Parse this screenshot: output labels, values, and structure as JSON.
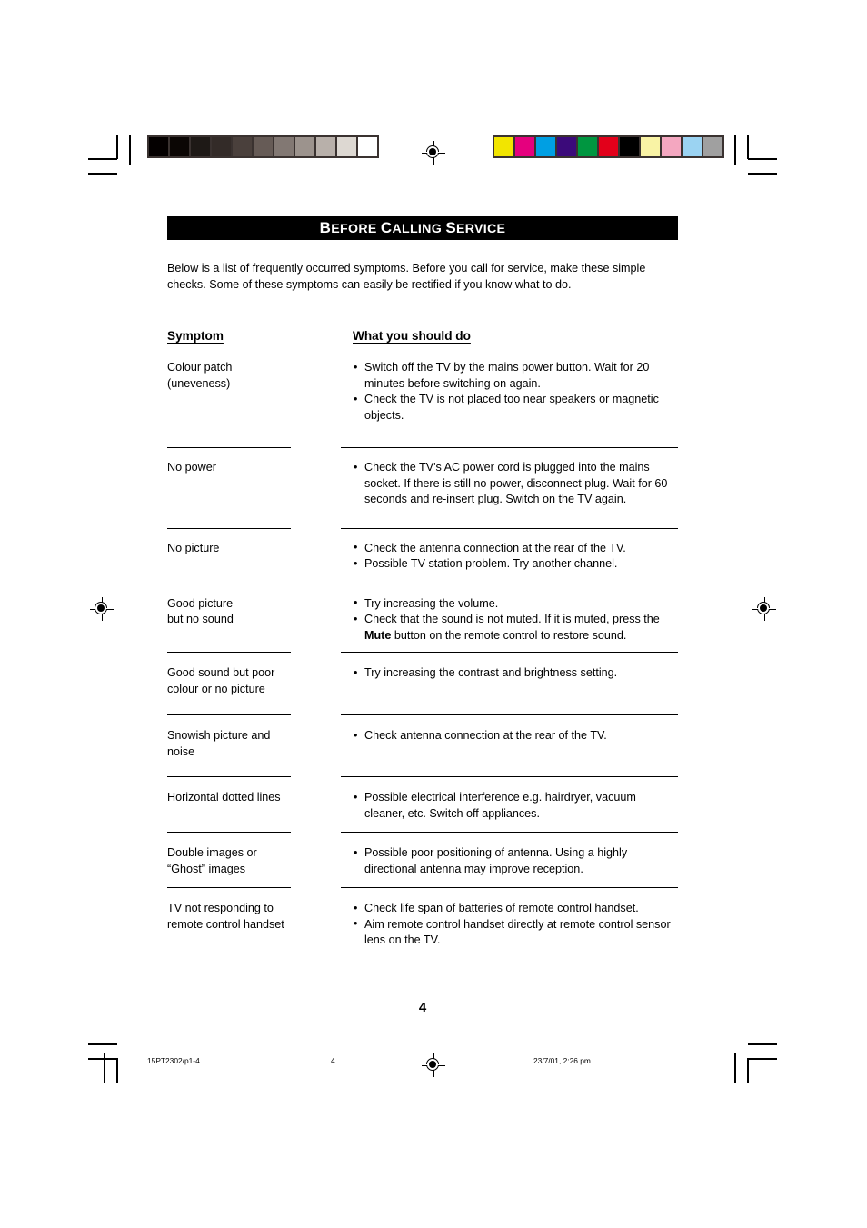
{
  "document": {
    "title_cap": "B",
    "title_rest": "EFORE ",
    "title_full": "BEFORE CALLING SERVICE",
    "title_words": [
      {
        "cap": "B",
        "rest": "EFORE"
      },
      {
        "cap": "C",
        "rest": "ALLING"
      },
      {
        "cap": "S",
        "rest": "ERVICE"
      }
    ],
    "intro": "Below is a list of frequently occurred symptoms. Before you call for service, make these simple checks. Some of these symptoms can easily be rectified if you know what to do.",
    "page_number": "4"
  },
  "table": {
    "headers": {
      "symptom": "Symptom",
      "action": "What you should do"
    },
    "rows": [
      {
        "symptom": "Colour patch\n(uneveness)",
        "symptom_lines": [
          "Colour patch",
          "(uneveness)"
        ],
        "actions": [
          "Switch off the TV by the mains power button. Wait for 20 minutes before switching on again.",
          "Check the TV is not placed too near speakers or magnetic objects."
        ]
      },
      {
        "symptom": "No power",
        "symptom_lines": [
          "No power"
        ],
        "actions": [
          "Check the TV's AC power cord is plugged into the mains socket. If there is still no power, disconnect plug. Wait for 60 seconds and re-insert plug. Switch on the TV again."
        ]
      },
      {
        "symptom": "No picture",
        "symptom_lines": [
          "No picture"
        ],
        "actions": [
          "Check the antenna connection at the rear of the TV.",
          "Possible TV station problem. Try another channel."
        ]
      },
      {
        "symptom": "Good picture\nbut no sound",
        "symptom_lines": [
          "Good picture",
          "but no sound"
        ],
        "actions": [
          "Try increasing the volume.",
          "Check that the sound is not muted. If it is muted, press the Mute button on the remote control to restore sound."
        ],
        "action_bold_term": "Mute"
      },
      {
        "symptom": "Good sound but poor\ncolour or no picture",
        "symptom_lines": [
          "Good sound but poor",
          "colour or no picture"
        ],
        "actions": [
          "Try increasing the contrast and brightness setting."
        ]
      },
      {
        "symptom": "Snowish picture and\nnoise",
        "symptom_lines": [
          "Snowish picture and",
          "noise"
        ],
        "actions": [
          "Check antenna connection at the rear of the TV."
        ]
      },
      {
        "symptom": "Horizontal dotted lines",
        "symptom_lines": [
          "Horizontal dotted lines"
        ],
        "actions": [
          "Possible electrical interference e.g. hairdryer, vacuum cleaner, etc. Switch off appliances."
        ]
      },
      {
        "symptom": "Double images or\n“Ghost” images",
        "symptom_lines": [
          "Double images or",
          "“Ghost” images"
        ],
        "actions": [
          "Possible poor positioning of antenna. Using a highly directional  antenna may improve reception."
        ]
      },
      {
        "symptom": "TV not responding to\nremote control handset",
        "symptom_lines": [
          "TV not responding to",
          "remote control handset"
        ],
        "actions": [
          "Check life span of batteries of remote control handset.",
          "Aim remote control handset directly at remote control sensor lens on the TV."
        ]
      }
    ],
    "bullet_glyph": "•"
  },
  "footer": {
    "file_ref": "15PT2302/p1-4",
    "page": "4",
    "timestamp": "23/7/01, 2:26 pm"
  },
  "print_marks": {
    "grayscale_patches": [
      "#040000",
      "#0b0604",
      "#1e1916",
      "#332b28",
      "#4a403c",
      "#665b56",
      "#827873",
      "#9c938d",
      "#b8b0aa",
      "#ddd8d2",
      "#ffffff"
    ],
    "colour_patches": [
      "#f2e500",
      "#e5007e",
      "#009fe3",
      "#3b0a7a",
      "#009640",
      "#e2001a",
      "#000000",
      "#f9f3a5",
      "#f4a7c0",
      "#9bd3f2",
      "#a0a0a0"
    ]
  }
}
